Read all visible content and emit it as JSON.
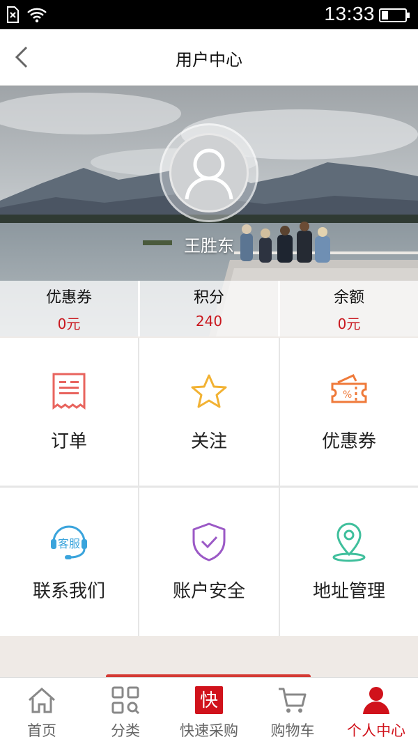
{
  "status_bar": {
    "time": "13:33"
  },
  "header": {
    "title": "用户中心"
  },
  "profile": {
    "username": "王胜东"
  },
  "stats": [
    {
      "label": "优惠券",
      "value": "0元"
    },
    {
      "label": "积分",
      "value": "240"
    },
    {
      "label": "余额",
      "value": "0元"
    }
  ],
  "menu": [
    {
      "label": "订单",
      "icon": "order-receipt-icon"
    },
    {
      "label": "关注",
      "icon": "star-icon"
    },
    {
      "label": "优惠券",
      "icon": "coupon-ticket-icon"
    },
    {
      "label": "联系我们",
      "icon": "customer-service-icon",
      "icon_text": "客服"
    },
    {
      "label": "账户安全",
      "icon": "shield-check-icon"
    },
    {
      "label": "地址管理",
      "icon": "location-pin-icon"
    }
  ],
  "tabbar": {
    "active_index": 4,
    "items": [
      {
        "label": "首页",
        "icon": "home-icon"
      },
      {
        "label": "分类",
        "icon": "category-grid-icon"
      },
      {
        "label": "快速采购",
        "icon": "quick-buy-icon",
        "icon_text": "快"
      },
      {
        "label": "购物车",
        "icon": "cart-icon"
      },
      {
        "label": "个人中心",
        "icon": "person-icon"
      }
    ]
  },
  "colors": {
    "accent_red": "#d0121b",
    "order_icon": "#e8645e",
    "star_icon": "#f2b233",
    "coupon_icon": "#ef7a3a",
    "service_icon": "#3aa4dc",
    "shield_icon": "#9b59c6",
    "pin_icon": "#3fbf9c"
  }
}
